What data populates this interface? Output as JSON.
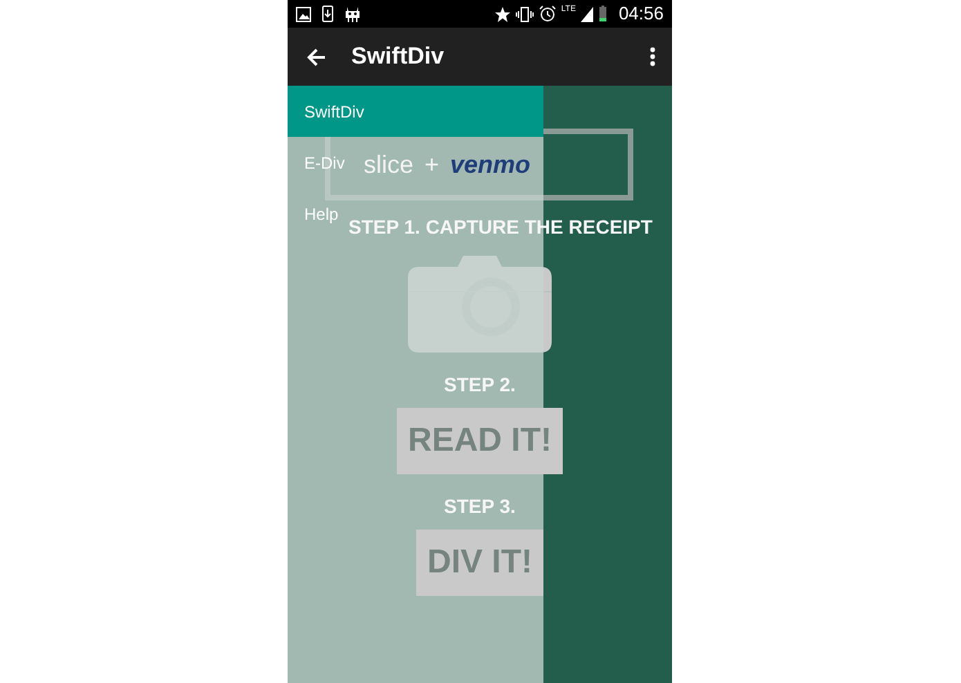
{
  "status_bar": {
    "network": "LTE",
    "time": "04:56"
  },
  "app_bar": {
    "title": "SwiftDiv"
  },
  "content": {
    "partner_logos": {
      "left": "slice",
      "joiner": "+",
      "right": "venmo"
    },
    "steps": [
      {
        "kind": "camera",
        "heading": "STEP 1. CAPTURE THE RECEIPT"
      },
      {
        "kind": "action",
        "heading": "STEP 2.",
        "action": "READ IT!"
      },
      {
        "kind": "action",
        "heading": "STEP 3.",
        "action": "DIV IT!"
      }
    ]
  },
  "drawer": {
    "items": [
      {
        "label": "SwiftDiv",
        "selected": true
      },
      {
        "label": "E-Div",
        "selected": false
      },
      {
        "label": "Help",
        "selected": false
      }
    ]
  }
}
